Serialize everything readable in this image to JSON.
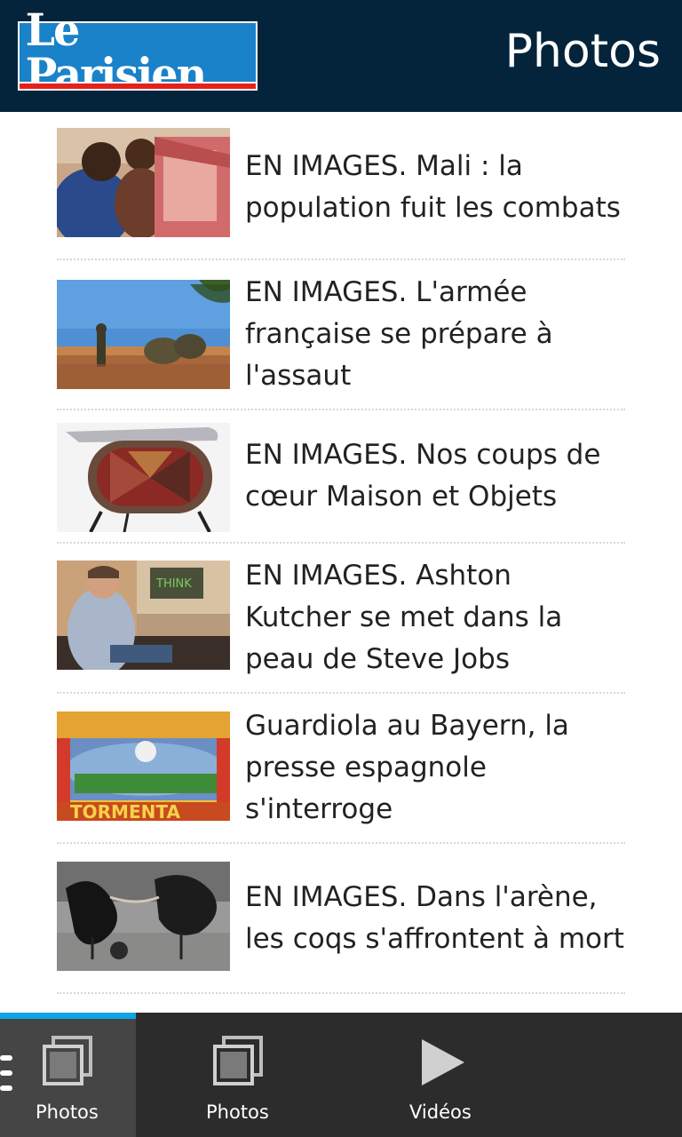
{
  "header": {
    "logo_text": "Le Parisien",
    "title": "Photos",
    "background": "#03243b"
  },
  "articles": [
    {
      "title": "EN IMAGES. Mali : la population fuit les combats",
      "thumbnail": "crowd-photo"
    },
    {
      "title": "EN IMAGES. L'armée française se prépare à l'assaut",
      "thumbnail": "soldiers-desert-photo"
    },
    {
      "title": "EN IMAGES. Nos coups de cœur Maison et Objets",
      "thumbnail": "cabinet-object-photo"
    },
    {
      "title": "EN IMAGES. Ashton Kutcher se met dans la peau de Steve Jobs",
      "thumbnail": "actor-photo"
    },
    {
      "title": "Guardiola au Bayern, la presse espagnole s'interroge",
      "thumbnail": "newspaper-cover-photo"
    },
    {
      "title": "EN IMAGES. Dans l'arène, les coqs s'affrontent à mort",
      "thumbnail": "cockfight-photo"
    }
  ],
  "bottom_bar": {
    "tabs": [
      {
        "label": "Photos",
        "icon": "photos-icon",
        "active": true
      },
      {
        "label": "Photos",
        "icon": "photos-icon",
        "active": false
      },
      {
        "label": "Vidéos",
        "icon": "play-icon",
        "active": false
      }
    ],
    "accent": "#0ea6e5"
  }
}
